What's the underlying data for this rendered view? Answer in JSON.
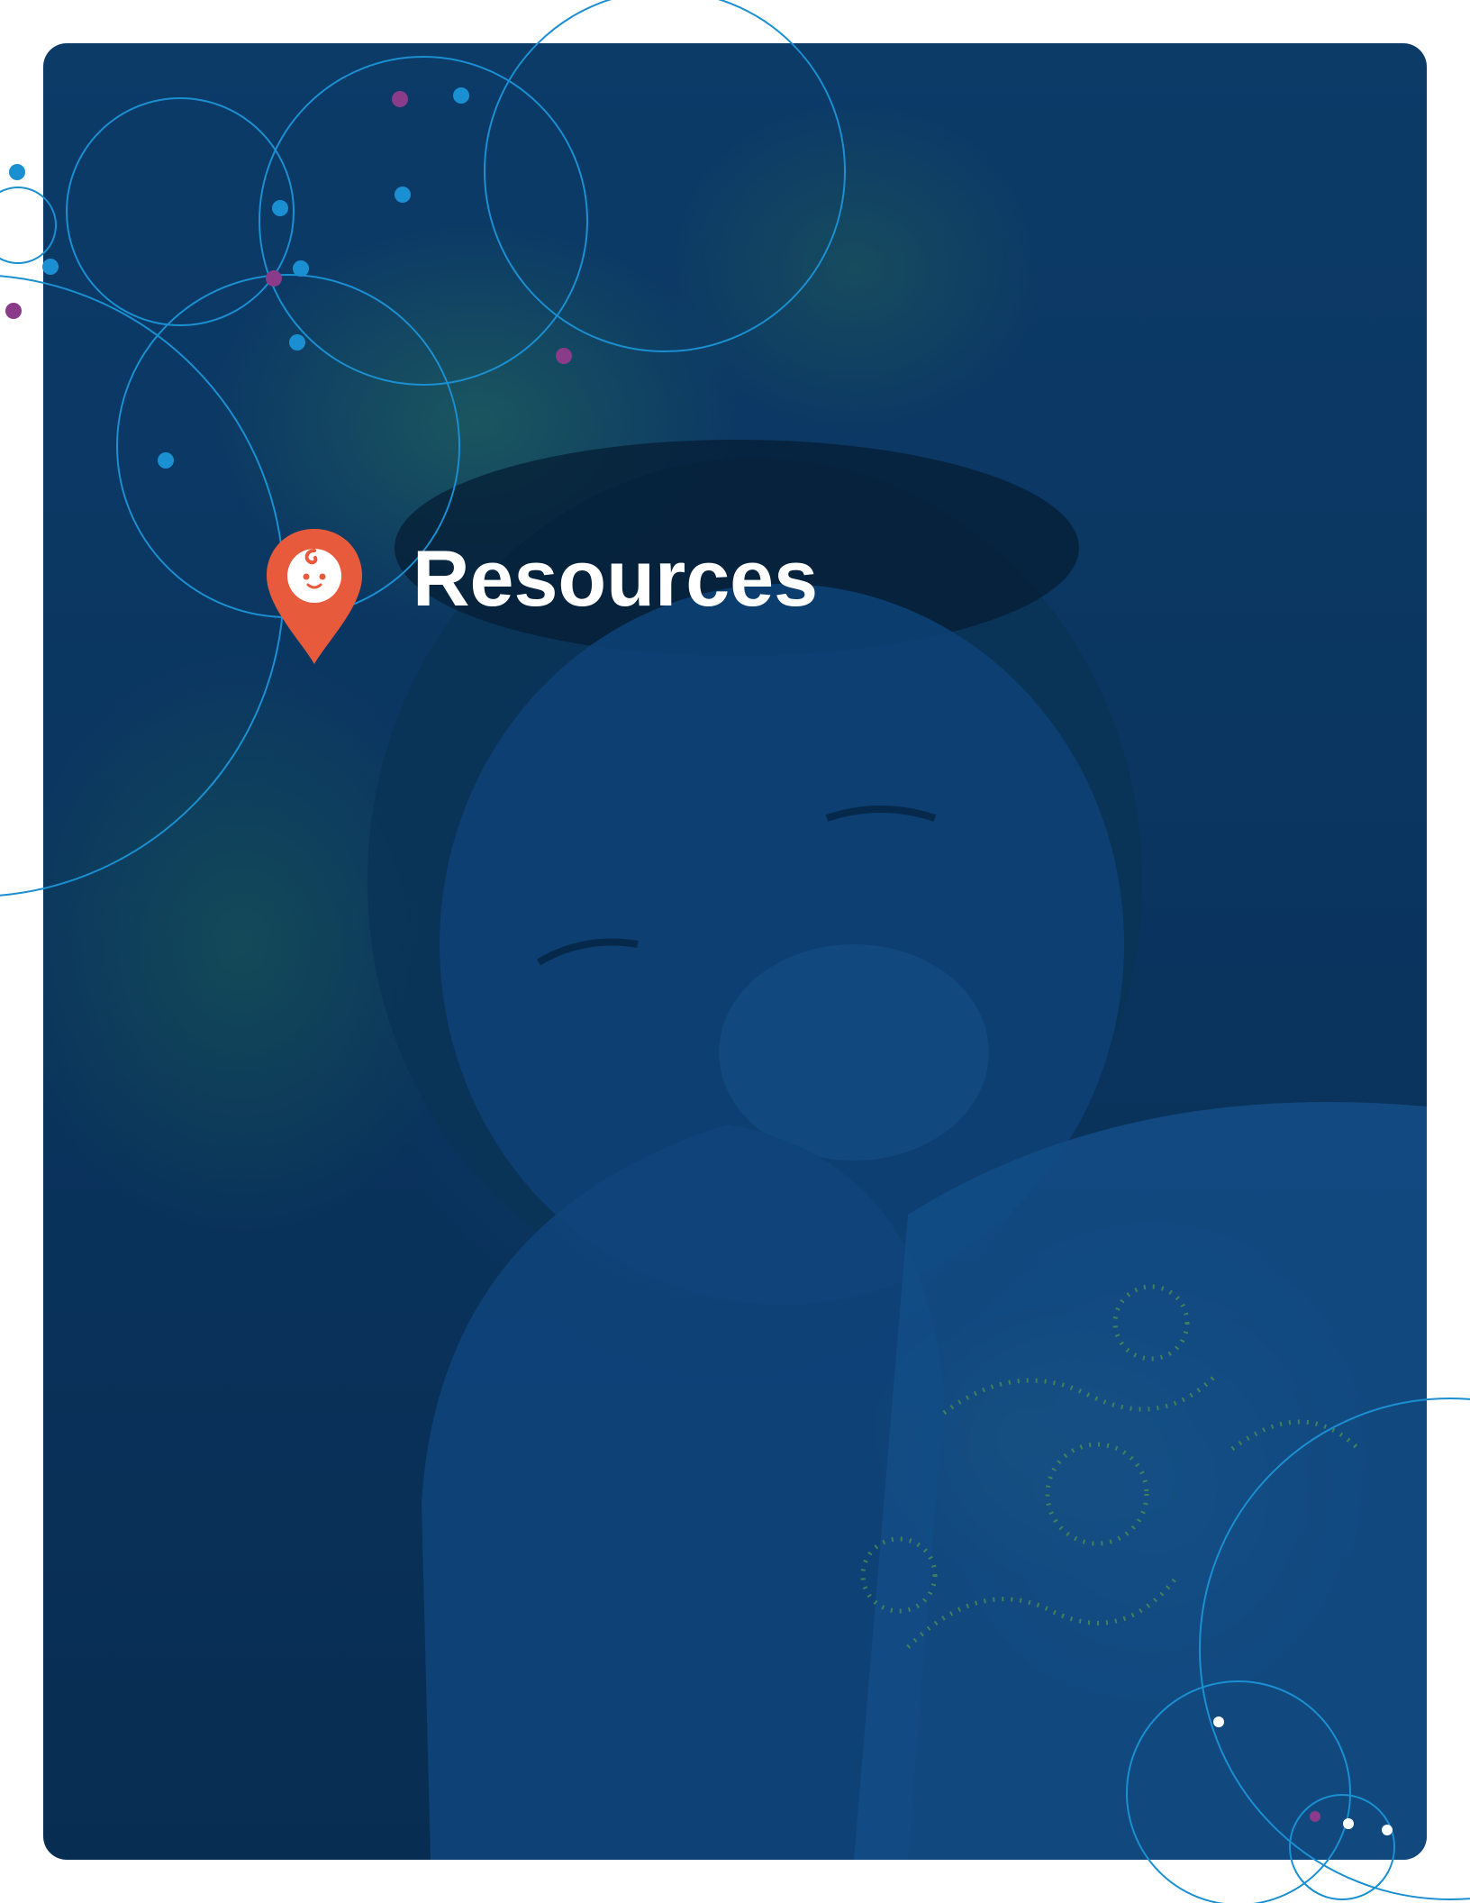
{
  "page": {
    "title": "Resources",
    "background_color": "#0b3864",
    "accent_color": "#e85a3c",
    "line_color": "#1a8fd1",
    "node_colors": [
      "#1a8fd1",
      "#8a3c8a",
      "#ffffff"
    ]
  },
  "icons": {
    "logo": "map-pin-baby-icon"
  }
}
